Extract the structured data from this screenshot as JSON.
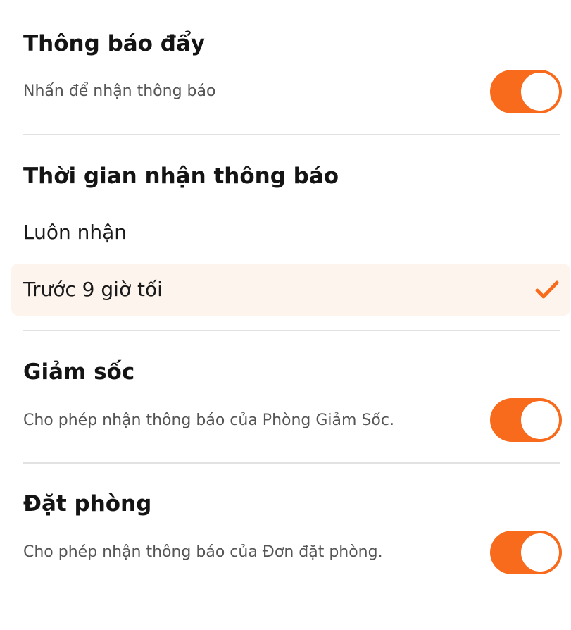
{
  "push": {
    "title": "Thông báo đẩy",
    "subtitle": "Nhấn để nhận thông báo",
    "enabled": true
  },
  "time": {
    "title": "Thời gian nhận thông báo",
    "options": [
      {
        "label": "Luôn nhận",
        "selected": false
      },
      {
        "label": "Trước 9 giờ tối",
        "selected": true
      }
    ]
  },
  "shock": {
    "title": "Giảm sốc",
    "subtitle": "Cho phép nhận thông báo của Phòng Giảm Sốc.",
    "enabled": true
  },
  "booking": {
    "title": "Đặt phòng",
    "subtitle": "Cho phép nhận thông báo của Đơn đặt phòng.",
    "enabled": true
  },
  "colors": {
    "accent": "#f96b1c",
    "selected_bg": "#fdf4ee",
    "divider": "#e2e2e2"
  }
}
